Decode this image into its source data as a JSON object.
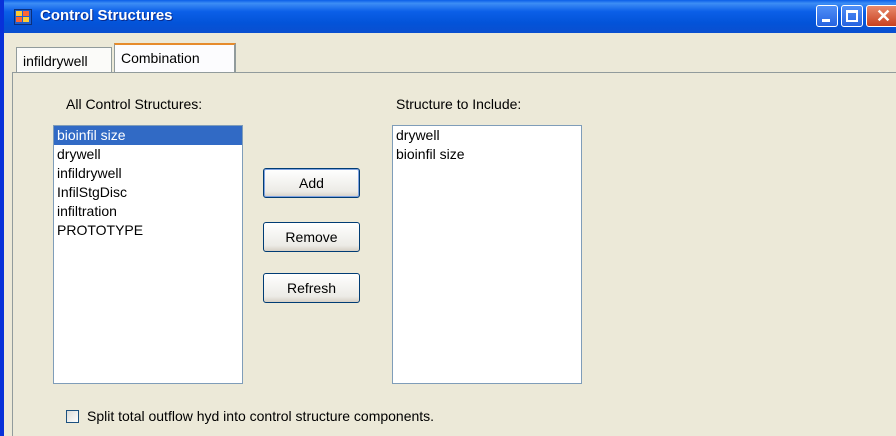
{
  "window": {
    "title": "Control Structures"
  },
  "titlebar_buttons": {
    "minimize": "minimize",
    "maximize": "maximize",
    "close": "close"
  },
  "tabs": [
    {
      "label": "infildrywell",
      "selected": false
    },
    {
      "label": "Combination",
      "selected": true
    }
  ],
  "left": {
    "label": "All Control Structures:",
    "items": [
      "bioinfil size",
      "drywell",
      "infildrywell",
      "InfilStgDisc",
      "infiltration",
      "PROTOTYPE"
    ],
    "selected_index": 0
  },
  "buttons": {
    "add": "Add",
    "remove": "Remove",
    "refresh": "Refresh"
  },
  "right": {
    "label": "Structure to Include:",
    "items": [
      "drywell",
      "bioinfil size"
    ]
  },
  "split_checkbox": {
    "label": "Split total outflow hyd into control structure components.",
    "checked": false
  },
  "colors": {
    "titlebar": "#0a5ee8",
    "selection": "#316ac5",
    "window_bg": "#ece9d8"
  }
}
